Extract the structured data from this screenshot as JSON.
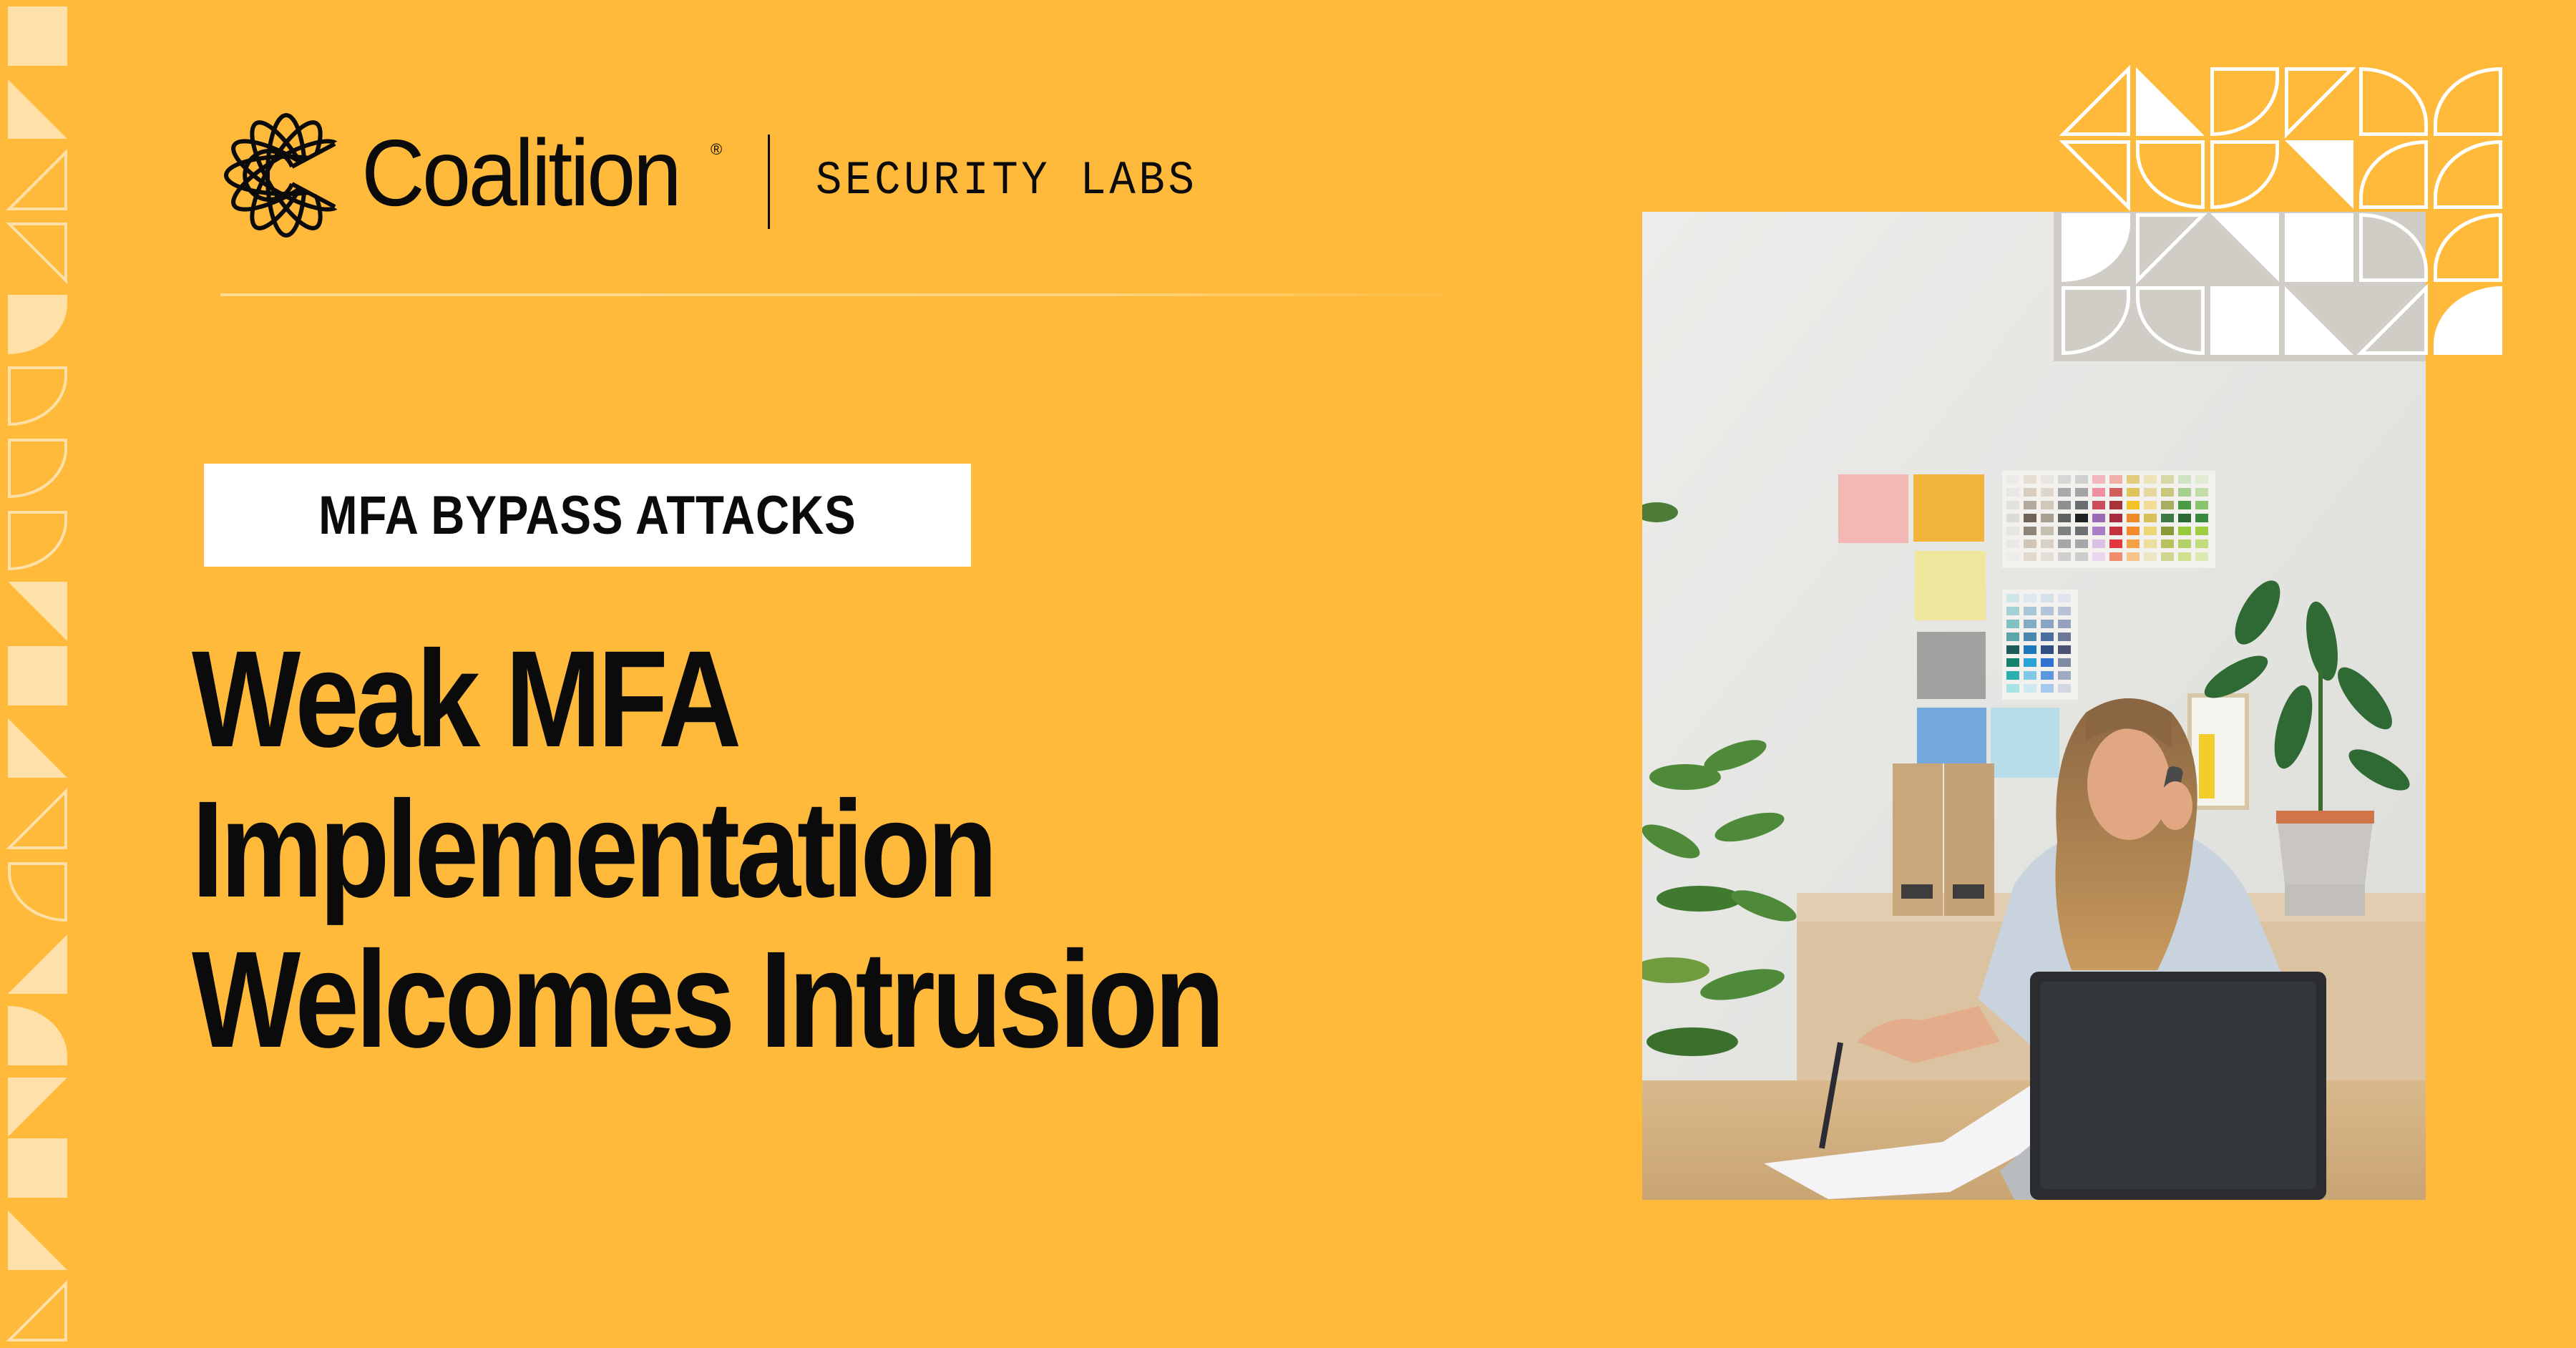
{
  "brand": {
    "name": "Coalition",
    "registered_mark": "®",
    "product": "SECURITY LABS",
    "logo_icon": "coalition-globe-c-icon"
  },
  "article": {
    "category": "MFA BYPASS ATTACKS",
    "headline_lines": [
      "Weak MFA",
      "Implementation",
      "Welcomes Intrusion"
    ]
  },
  "photo": {
    "subject": "woman on phone at desk with laptop, color swatches on wall"
  },
  "colors": {
    "background": "#FFBA3C",
    "text": "#0B0B0B",
    "tag_background": "#FFFFFF",
    "pattern_light": "#FFE0A8",
    "pattern_white": "#FFFFFF"
  },
  "decor": {
    "left_strip": [
      {
        "shape": "square",
        "style": "fill"
      },
      {
        "shape": "tri-tl-bl-br",
        "style": "fill"
      },
      {
        "shape": "tri-tr-bl-br",
        "style": "outline"
      },
      {
        "shape": "tri-tl-tr-br",
        "style": "outline"
      },
      {
        "shape": "arc-br",
        "style": "fill"
      },
      {
        "shape": "arc-br",
        "style": "outline"
      },
      {
        "shape": "arc-br",
        "style": "outline"
      },
      {
        "shape": "arc-br",
        "style": "outline"
      },
      {
        "shape": "tri-tl-tr-br",
        "style": "fill"
      },
      {
        "shape": "square",
        "style": "fill"
      },
      {
        "shape": "tri-tl-bl-br",
        "style": "fill"
      },
      {
        "shape": "tri-tr-bl-br",
        "style": "outline"
      },
      {
        "shape": "arc-bl",
        "style": "outline"
      },
      {
        "shape": "tri-tr-bl-br",
        "style": "fill"
      },
      {
        "shape": "arc-tr",
        "style": "fill"
      },
      {
        "shape": "tri-tl-tr-bl",
        "style": "fill"
      },
      {
        "shape": "square",
        "style": "fill"
      },
      {
        "shape": "tri-tl-bl-br",
        "style": "fill"
      },
      {
        "shape": "tri-tr-bl-br",
        "style": "outline"
      }
    ],
    "corner_grid": [
      [
        {
          "shape": "tri-tr-bl-br",
          "style": "outline"
        },
        {
          "shape": "tri-tl-bl-br",
          "style": "fill"
        },
        {
          "shape": "arc-br",
          "style": "outline"
        },
        {
          "shape": "tri-tl-tr-bl",
          "style": "outline"
        },
        {
          "shape": "arc-tr",
          "style": "outline"
        },
        {
          "shape": "arc-tl",
          "style": "outline"
        }
      ],
      [
        {
          "shape": "tri-tl-tr-br",
          "style": "outline"
        },
        {
          "shape": "arc-bl",
          "style": "outline"
        },
        {
          "shape": "arc-br",
          "style": "outline"
        },
        {
          "shape": "tri-tl-tr-br",
          "style": "fill"
        },
        {
          "shape": "arc-tl",
          "style": "outline"
        },
        {
          "shape": "arc-tl",
          "style": "outline"
        }
      ],
      [
        {
          "shape": "arc-br",
          "style": "fill"
        },
        {
          "shape": "tri-tl-tr-bl",
          "style": "outline"
        },
        {
          "shape": "tri-tl-tr-br",
          "style": "fill"
        },
        {
          "shape": "square",
          "style": "fill"
        },
        {
          "shape": "arc-tr",
          "style": "outline"
        },
        {
          "shape": "arc-tl",
          "style": "outline"
        }
      ],
      [
        {
          "shape": "arc-br",
          "style": "outline"
        },
        {
          "shape": "arc-bl",
          "style": "outline"
        },
        {
          "shape": "square",
          "style": "fill"
        },
        {
          "shape": "tri-tl-bl-br",
          "style": "fill"
        },
        {
          "shape": "tri-tr-bl-br",
          "style": "outline"
        },
        {
          "shape": "arc-tl",
          "style": "fill"
        }
      ]
    ]
  }
}
